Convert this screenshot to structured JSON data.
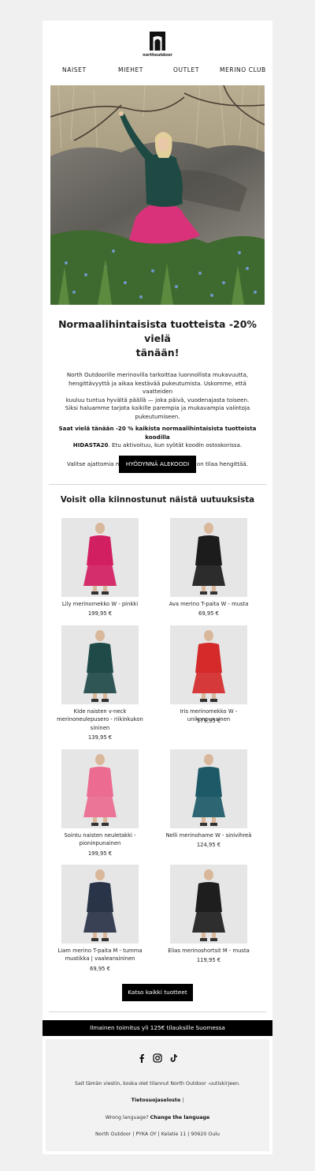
{
  "brand": {
    "logo_text": "northoutdoor"
  },
  "nav": {
    "items": [
      "NAISET",
      "MIEHET",
      "OUTLET",
      "MERINO CLUB"
    ]
  },
  "hero": {
    "image_alt": "Nainen pinkissä hameessa ja vihreässä neuleessa kalliolla"
  },
  "main": {
    "headline_line1": "Normaalihintaisista tuotteista -20% vielä",
    "headline_line2": "tänään!",
    "body_lines": [
      "North Outdoorille merinovilla tarkoittaa luonnollista mukavuutta,",
      "hengittävyyttä ja aikaa kestävää pukeutumista. Uskomme, että vaatteiden",
      "kuuluu tuntua hyvältä päällä — joka päivä, vuodenajasta toiseen.",
      "Siksi haluamme tarjota kaikille parempia ja mukavampia valintoja",
      "pukeutumiseen."
    ],
    "offer_bold_line1": "Saat vielä tänään -20 % kaikista normaalihintaisista tuotteista",
    "offer_bold_line2": "koodilla",
    "offer_code": "HIDASTA20",
    "offer_rest": ". Etu aktivoituu, kun syötät koodin ostoskorissa.",
    "tagline": "Valitse ajattomia merinovillasuosikkeja, joissa on tilaa hengittää.",
    "cta_label": "HYÖDYNNÄ ALEKOODI"
  },
  "products_section": {
    "title": "Voisit olla kiinnostunut näistä uutuuksista",
    "items": [
      {
        "name": [
          "Lily merinomekko W - pinkki"
        ],
        "price": "199,95 €",
        "color": "#d21f62"
      },
      {
        "name": [
          "Ava merino T-paita W - musta"
        ],
        "price": "69,95 €",
        "color": "#1c1c1c"
      },
      {
        "name": [
          "Kide naisten v-neck",
          "merinoneulepusero - riikinkukon",
          "sininen"
        ],
        "price": "139,95 €",
        "color": "#1f4a48"
      },
      {
        "name": [
          "Iris merinomekko W - unikonpunainen"
        ],
        "price": "179,95 €",
        "color": "#d42a2a"
      },
      {
        "name": [
          "Sointu naisten neuletakki -",
          "pioninpunainen"
        ],
        "price": "199,95 €",
        "color": "#ec6b90"
      },
      {
        "name": [
          "Nelli merinohame W - sinivihreä"
        ],
        "price": "124,95 €",
        "color": "#1d5a68"
      },
      {
        "name": [
          "Liam merino T-paita M - tumma",
          "mustikka | vaaleansininen"
        ],
        "price": "69,95 €",
        "color": "#2a3448"
      },
      {
        "name": [
          "Elias merinoshortsit M - musta"
        ],
        "price": "119,95 €",
        "color": "#1e1e1e"
      }
    ],
    "view_all_label": "Katso kaikki tuotteet"
  },
  "shipping_bar": {
    "text": "Ilmainen toimitus yli 125€ tilauksille Suomessa"
  },
  "footer": {
    "reason": "Sait tämän viestin, koska olet tilannut North Outdoor -uutiskirjeen.",
    "privacy_label": "Tietosuojaseloste",
    "privacy_sep": " |",
    "language_prefix": "Wrong language? ",
    "language_link": "Change the language",
    "address": "North Outdoor | PYKA OY | Kelatie 11 | 90620 Oulu",
    "social_icons": [
      "facebook-icon",
      "instagram-icon",
      "tiktok-icon"
    ]
  }
}
